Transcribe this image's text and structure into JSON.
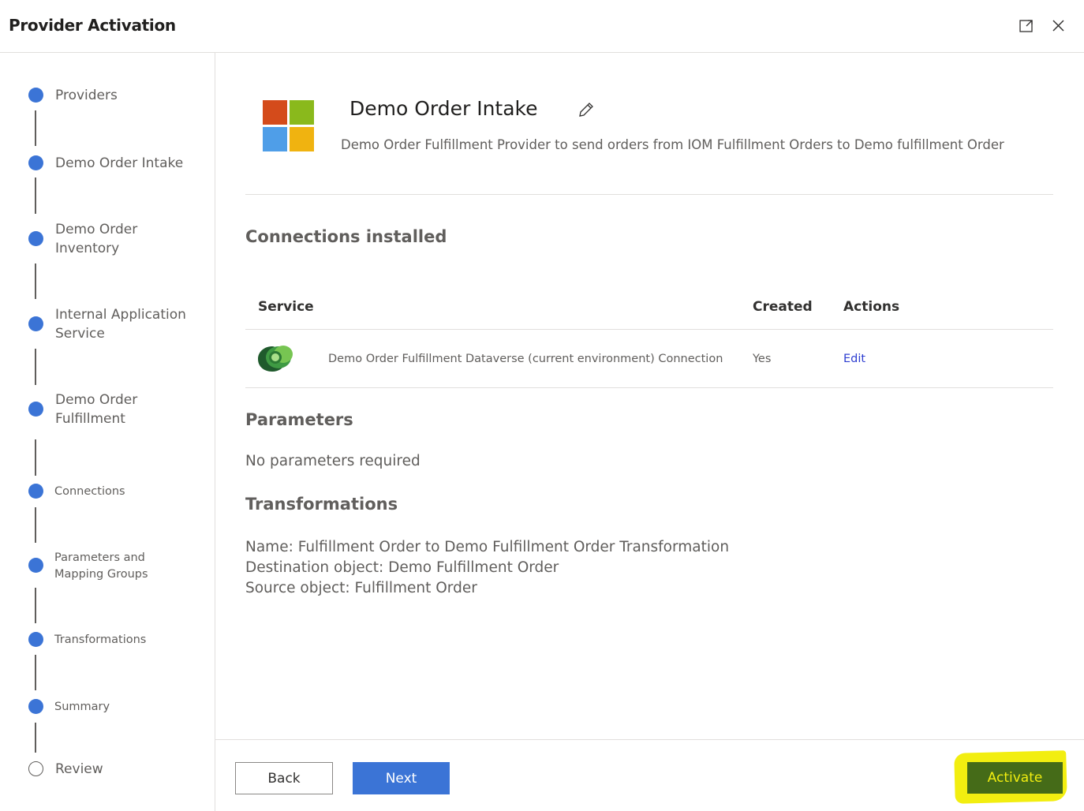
{
  "dialog": {
    "title": "Provider Activation",
    "expand_icon": "expand-icon",
    "close_icon": "close-icon"
  },
  "steps": [
    {
      "label": "Providers",
      "status": "complete"
    },
    {
      "label": "Demo Order Intake",
      "status": "complete"
    },
    {
      "label": "Demo Order Inventory",
      "line1": "Demo Order",
      "line2": "Inventory",
      "status": "complete"
    },
    {
      "label": "Internal Application Service",
      "line1": "Internal Application",
      "line2": "Service",
      "status": "complete"
    },
    {
      "label": "Demo Order Fulfillment",
      "line1": "Demo Order",
      "line2": "Fulfillment",
      "status": "complete"
    },
    {
      "label": "Connections",
      "status": "complete"
    },
    {
      "label": "Parameters and Mapping Groups",
      "line1": "Parameters and",
      "line2": "Mapping Groups",
      "status": "complete"
    },
    {
      "label": "Transformations",
      "status": "complete"
    },
    {
      "label": "Summary",
      "status": "complete"
    },
    {
      "label": "Review",
      "status": "current"
    }
  ],
  "provider": {
    "name": "Demo Order Intake",
    "description": "Demo Order Fulfillment Provider to send orders from IOM Fulfillment Orders to Demo fulfillment Order",
    "logo_colors": [
      "#d44b1b",
      "#8ab91c",
      "#4f9ee8",
      "#f0b310"
    ]
  },
  "connections": {
    "title": "Connections installed",
    "columns": [
      "Service",
      "Created",
      "Actions"
    ],
    "rows": [
      {
        "service": "Demo Order Fulfillment Dataverse (current environment) Connection",
        "created": "Yes",
        "action": "Edit",
        "icon": "dataverse-icon"
      }
    ]
  },
  "parameters": {
    "title": "Parameters",
    "text": "No parameters required"
  },
  "transformations": {
    "title": "Transformations",
    "name": "Name: Fulfillment Order to Demo Fulfillment Order Transformation",
    "destination": "Destination object: Demo Fulfillment Order",
    "source": "Source object: Fulfillment Order"
  },
  "footer": {
    "back_label": "Back",
    "next_label": "Next",
    "activate_label": "Activate"
  },
  "colors": {
    "accent": "#3b74d6",
    "highlight": "#f2ee10",
    "activate_bg": "#456b18"
  }
}
